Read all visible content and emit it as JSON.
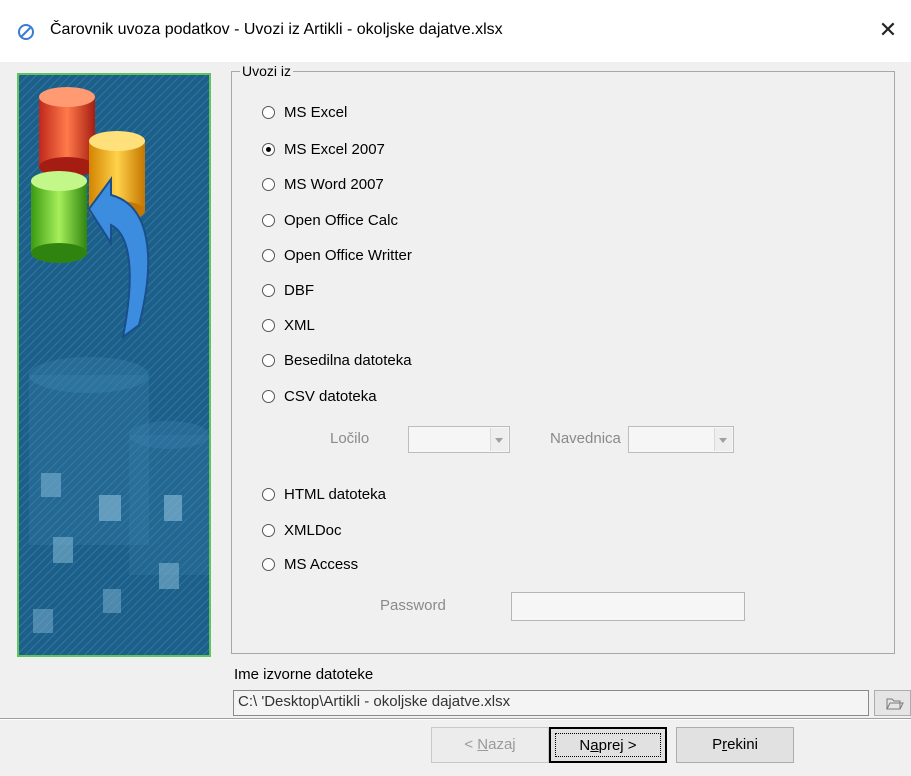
{
  "window": {
    "title": "Čarovnik uvoza podatkov - Uvozi iz Artikli - okoljske dajatve.xlsx",
    "close_glyph": "✕"
  },
  "group": {
    "legend": "Uvozi iz",
    "selected": "MS Excel 2007",
    "options": [
      {
        "label": "MS Excel",
        "checked": false
      },
      {
        "label": "MS Excel 2007",
        "checked": true
      },
      {
        "label": "MS Word 2007",
        "checked": false
      },
      {
        "label": "Open Office Calc",
        "checked": false
      },
      {
        "label": "Open Office Writter",
        "checked": false
      },
      {
        "label": "DBF",
        "checked": false
      },
      {
        "label": "XML",
        "checked": false
      },
      {
        "label": "Besedilna datoteka",
        "checked": false
      },
      {
        "label": "CSV datoteka",
        "checked": false
      },
      {
        "label": "HTML datoteka",
        "checked": false
      },
      {
        "label": "XMLDoc",
        "checked": false
      },
      {
        "label": "MS Access",
        "checked": false
      }
    ],
    "csv": {
      "delimiter_label": "Ločilo",
      "delimiter_value": "",
      "quote_label": "Navednica",
      "quote_value": ""
    },
    "access": {
      "password_label": "Password",
      "password_value": ""
    }
  },
  "source": {
    "label": "Ime izvorne datoteke",
    "path": "C:\\                    'Desktop\\Artikli - okoljske dajatve.xlsx"
  },
  "buttons": {
    "back_prefix": "< ",
    "back_mnemonic": "N",
    "back_rest": "azaj",
    "next_prefix": "N",
    "next_mnemonic": "a",
    "next_rest": "prej >",
    "cancel_prefix": "P",
    "cancel_mnemonic": "r",
    "cancel_rest": "ekini"
  },
  "colors": {
    "panel_border": "#5fc35f",
    "panel_background": "#1f5f86"
  },
  "icons": {
    "app": "app-logo-icon",
    "close": "close-icon",
    "browse": "folder-open-icon",
    "dropdown": "chevron-down-icon"
  }
}
